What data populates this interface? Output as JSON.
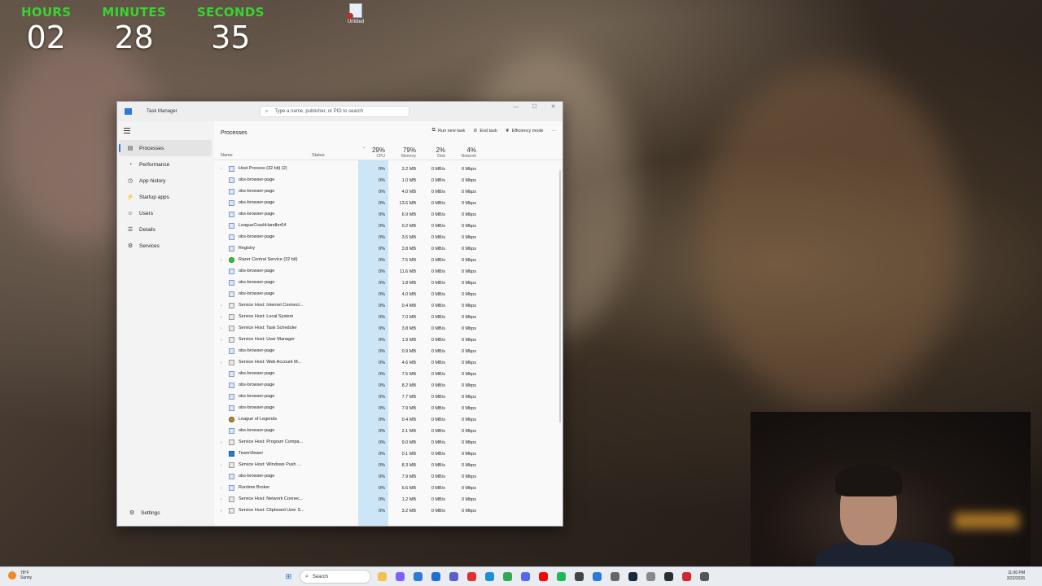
{
  "countdown": {
    "hours_label": "HOURS",
    "hours": "02",
    "minutes_label": "MINUTES",
    "minutes": "28",
    "seconds_label": "SECONDS",
    "seconds": "35"
  },
  "desktop": {
    "icon_label": "Untitled"
  },
  "task_manager": {
    "title": "Task Manager",
    "search_placeholder": "Type a name, publisher, or PID to search",
    "nav": [
      {
        "label": "Processes",
        "icon": "processes-icon",
        "glyph": "▤"
      },
      {
        "label": "Performance",
        "icon": "performance-icon",
        "glyph": "◔"
      },
      {
        "label": "App history",
        "icon": "history-icon",
        "glyph": "◷"
      },
      {
        "label": "Startup apps",
        "icon": "startup-icon",
        "glyph": "⚡"
      },
      {
        "label": "Users",
        "icon": "users-icon",
        "glyph": "☺"
      },
      {
        "label": "Details",
        "icon": "details-icon",
        "glyph": "☰"
      },
      {
        "label": "Services",
        "icon": "services-icon",
        "glyph": "⚙"
      }
    ],
    "settings_label": "Settings",
    "page_title": "Processes",
    "actions": {
      "run_new_task": "Run new task",
      "end_task": "End task",
      "efficiency_mode": "Efficiency mode",
      "more": "···"
    },
    "columns": {
      "name": "Name",
      "status": "Status",
      "cpu_pct": "29%",
      "cpu": "CPU",
      "mem_pct": "79%",
      "mem": "Memory",
      "disk_pct": "2%",
      "disk": "Disk",
      "net_pct": "4%",
      "net": "Network"
    },
    "rows": [
      {
        "name": "Host Process (32 bit) (2)",
        "icon": "host-icon",
        "expand": true,
        "cpu": "0%",
        "mem": "3.2 MB",
        "disk": "0 MB/s",
        "net": "0 Mbps"
      },
      {
        "name": "obs-browser-page",
        "icon": "app-icon",
        "expand": false,
        "cpu": "0%",
        "mem": "1.0 MB",
        "disk": "0 MB/s",
        "net": "0 Mbps"
      },
      {
        "name": "obs-browser-page",
        "icon": "app-icon",
        "expand": false,
        "cpu": "0%",
        "mem": "4.0 MB",
        "disk": "0 MB/s",
        "net": "0 Mbps"
      },
      {
        "name": "obs-browser-page",
        "icon": "app-icon",
        "expand": false,
        "cpu": "0%",
        "mem": "13.6 MB",
        "disk": "0 MB/s",
        "net": "0 Mbps"
      },
      {
        "name": "obs-browser-page",
        "icon": "app-icon",
        "expand": false,
        "cpu": "0%",
        "mem": "6.9 MB",
        "disk": "0 MB/s",
        "net": "0 Mbps"
      },
      {
        "name": "LeagueCrashHandler64",
        "icon": "app-icon",
        "expand": false,
        "cpu": "0%",
        "mem": "0.2 MB",
        "disk": "0 MB/s",
        "net": "0 Mbps"
      },
      {
        "name": "obs-browser-page",
        "icon": "app-icon",
        "expand": false,
        "cpu": "0%",
        "mem": "3.5 MB",
        "disk": "0 MB/s",
        "net": "0 Mbps"
      },
      {
        "name": "Registry",
        "icon": "app-icon",
        "expand": false,
        "cpu": "0%",
        "mem": "3.8 MB",
        "disk": "0 MB/s",
        "net": "0 Mbps"
      },
      {
        "name": "Razer Central Service (32 bit)",
        "icon": "razer-icon",
        "expand": true,
        "cpu": "0%",
        "mem": "7.5 MB",
        "disk": "0 MB/s",
        "net": "0 Mbps"
      },
      {
        "name": "obs-browser-page",
        "icon": "app-icon",
        "expand": false,
        "cpu": "0%",
        "mem": "11.6 MB",
        "disk": "0 MB/s",
        "net": "0 Mbps"
      },
      {
        "name": "obs-browser-page",
        "icon": "app-icon",
        "expand": false,
        "cpu": "0%",
        "mem": "1.8 MB",
        "disk": "0 MB/s",
        "net": "0 Mbps"
      },
      {
        "name": "obs-browser-page",
        "icon": "app-icon",
        "expand": false,
        "cpu": "0%",
        "mem": "4.0 MB",
        "disk": "0 MB/s",
        "net": "0 Mbps"
      },
      {
        "name": "Service Host: Internet Connect...",
        "icon": "service-icon",
        "expand": true,
        "cpu": "0%",
        "mem": "0.4 MB",
        "disk": "0 MB/s",
        "net": "0 Mbps"
      },
      {
        "name": "Service Host: Local System",
        "icon": "service-icon",
        "expand": true,
        "cpu": "0%",
        "mem": "7.0 MB",
        "disk": "0 MB/s",
        "net": "0 Mbps"
      },
      {
        "name": "Service Host: Task Scheduler",
        "icon": "service-icon",
        "expand": true,
        "cpu": "0%",
        "mem": "3.8 MB",
        "disk": "0 MB/s",
        "net": "0 Mbps"
      },
      {
        "name": "Service Host: User Manager",
        "icon": "service-icon",
        "expand": true,
        "cpu": "0%",
        "mem": "1.9 MB",
        "disk": "0 MB/s",
        "net": "0 Mbps"
      },
      {
        "name": "obs-browser-page",
        "icon": "app-icon",
        "expand": false,
        "cpu": "0%",
        "mem": "0.9 MB",
        "disk": "0 MB/s",
        "net": "0 Mbps"
      },
      {
        "name": "Service Host: Web Account M...",
        "icon": "service-icon",
        "expand": true,
        "cpu": "0%",
        "mem": "4.6 MB",
        "disk": "0 MB/s",
        "net": "0 Mbps"
      },
      {
        "name": "obs-browser-page",
        "icon": "app-icon",
        "expand": false,
        "cpu": "0%",
        "mem": "7.5 MB",
        "disk": "0 MB/s",
        "net": "0 Mbps"
      },
      {
        "name": "obs-browser-page",
        "icon": "app-icon",
        "expand": false,
        "cpu": "0%",
        "mem": "8.2 MB",
        "disk": "0 MB/s",
        "net": "0 Mbps"
      },
      {
        "name": "obs-browser-page",
        "icon": "app-icon",
        "expand": false,
        "cpu": "0%",
        "mem": "7.7 MB",
        "disk": "0 MB/s",
        "net": "0 Mbps"
      },
      {
        "name": "obs-browser-page",
        "icon": "app-icon",
        "expand": false,
        "cpu": "0%",
        "mem": "7.9 MB",
        "disk": "0 MB/s",
        "net": "0 Mbps"
      },
      {
        "name": "League of Legends",
        "icon": "lol-icon",
        "expand": false,
        "cpu": "0%",
        "mem": "0.4 MB",
        "disk": "0 MB/s",
        "net": "0 Mbps"
      },
      {
        "name": "obs-browser-page",
        "icon": "app-icon",
        "expand": false,
        "cpu": "0%",
        "mem": "2.1 MB",
        "disk": "0 MB/s",
        "net": "0 Mbps"
      },
      {
        "name": "Service Host: Program Compa...",
        "icon": "service-icon",
        "expand": true,
        "cpu": "0%",
        "mem": "9.0 MB",
        "disk": "0 MB/s",
        "net": "0 Mbps"
      },
      {
        "name": "TeamViewer",
        "icon": "teamviewer-icon",
        "expand": false,
        "cpu": "0%",
        "mem": "0.1 MB",
        "disk": "0 MB/s",
        "net": "0 Mbps"
      },
      {
        "name": "Service Host: Windows Push ...",
        "icon": "service-icon",
        "expand": true,
        "cpu": "0%",
        "mem": "8.3 MB",
        "disk": "0 MB/s",
        "net": "0 Mbps"
      },
      {
        "name": "obs-browser-page",
        "icon": "app-icon",
        "expand": false,
        "cpu": "0%",
        "mem": "7.9 MB",
        "disk": "0 MB/s",
        "net": "0 Mbps"
      },
      {
        "name": "Runtime Broker",
        "icon": "app-icon",
        "expand": true,
        "cpu": "0%",
        "mem": "6.6 MB",
        "disk": "0 MB/s",
        "net": "0 Mbps"
      },
      {
        "name": "Service Host: Network Connec...",
        "icon": "service-icon",
        "expand": true,
        "cpu": "0%",
        "mem": "1.2 MB",
        "disk": "0 MB/s",
        "net": "0 Mbps"
      },
      {
        "name": "Service Host: Clipboard User S...",
        "icon": "service-icon",
        "expand": true,
        "cpu": "0%",
        "mem": "3.2 MB",
        "disk": "0 MB/s",
        "net": "0 Mbps"
      }
    ]
  },
  "taskbar": {
    "weather_temp": "78°F",
    "weather_cond": "Sunny",
    "search_label": "Search",
    "time": "11:00 PM",
    "date": "3/22/2026",
    "apps": [
      "file-explorer-icon",
      "copilot-icon",
      "photos-icon",
      "store-icon",
      "teams-icon",
      "opera-icon",
      "edge-icon",
      "chrome-icon",
      "discord-icon",
      "youtube-icon",
      "spotify-icon",
      "app-icon",
      "app-icon",
      "app-icon",
      "steam-icon",
      "app-icon",
      "obs-icon",
      "app-icon",
      "app-icon"
    ]
  }
}
